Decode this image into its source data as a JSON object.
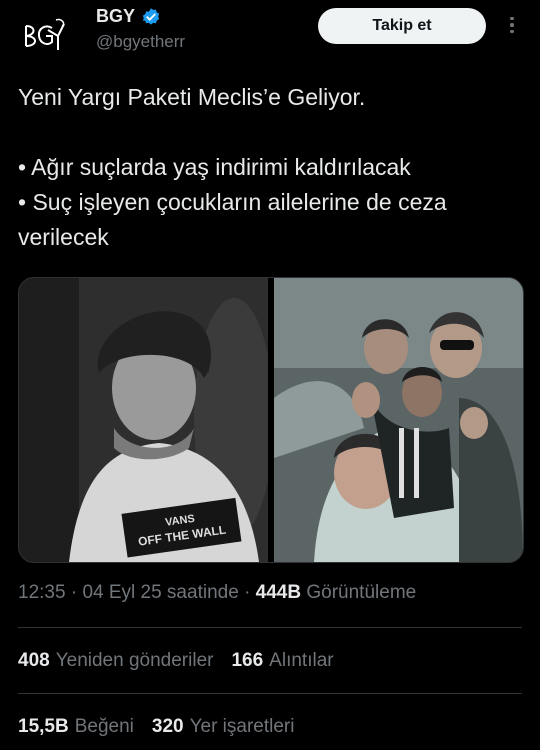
{
  "author": {
    "display_name": "BGY",
    "handle": "@bgyetherr",
    "avatar_icon": "bgy-logo-icon",
    "verified_icon": "verified-badge-icon",
    "verified_color": "#1d9bf0"
  },
  "actions": {
    "follow_label": "Takip et",
    "more_icon": "more-options-icon"
  },
  "tweet": {
    "line1": "Yeni Yargı Paketi Meclis’e Geliyor.",
    "bullet1": "• Ağır suçlarda yaş indirimi kaldırılacak",
    "bullet2": "• Suç işleyen çocukların ailelerine de ceza verilecek"
  },
  "meta": {
    "time": "12:35",
    "separator": "·",
    "date": "04 Eyl 25 saatinde",
    "views_count": "444B",
    "views_label": "Görüntüleme"
  },
  "stats": {
    "reposts_count": "408",
    "reposts_label": "Yeniden gönderiler",
    "quotes_count": "166",
    "quotes_label": "Alıntılar",
    "likes_count": "15,5B",
    "likes_label": "Beğeni",
    "bookmarks_count": "320",
    "bookmarks_label": "Yer işaretleri"
  },
  "media": {
    "left_image_shirt_text": "VANS OFF THE WALL",
    "images": [
      "photo-boy-portrait",
      "photo-group-selfie"
    ]
  },
  "colors": {
    "background": "#000000",
    "primary_text": "#e7e9ea",
    "secondary_text": "#71767b",
    "divider": "#2f3336",
    "button_bg": "#eff3f4"
  }
}
